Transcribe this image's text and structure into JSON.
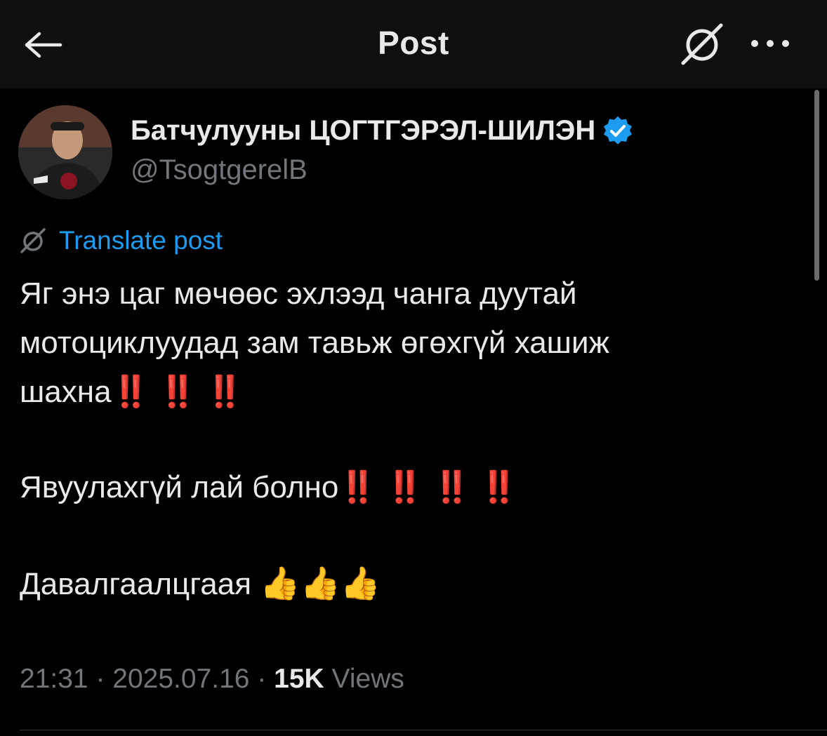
{
  "header": {
    "title": "Post",
    "back_icon": "arrow-left-icon",
    "grok_icon": "grok-icon",
    "more_icon": "more-horizontal-icon"
  },
  "author": {
    "name": "Батчулууны ЦОГТГЭРЭЛ-ШИЛЭН",
    "handle": "@TsogtgerelB",
    "verified": true,
    "verified_color": "#1d9bf0"
  },
  "translate": {
    "label": "Translate post",
    "icon": "grok-icon"
  },
  "post": {
    "line1": "Яг энэ цаг мөчөөс эхлээд чанга дуутай",
    "line2": "мотоциклуудад зам тавьж өгөхгүй хашиж",
    "line3_text": "шахна",
    "line3_emoji": "‼️ ‼️ ‼️",
    "line4_text": "Явуулахгүй лай болно",
    "line4_emoji": "‼️ ‼️ ‼️ ‼️",
    "line5_text": "Давалгаалцгаая ",
    "line5_emoji": "👍👍👍"
  },
  "meta": {
    "time": "21:31",
    "separator": " · ",
    "date": "2025.07.16",
    "views_count": "15K",
    "views_label": " Views"
  },
  "colors": {
    "background": "#000000",
    "text": "#e7e9ea",
    "muted": "#71767b",
    "accent": "#1d9bf0",
    "exclamation": "#e2212b"
  }
}
